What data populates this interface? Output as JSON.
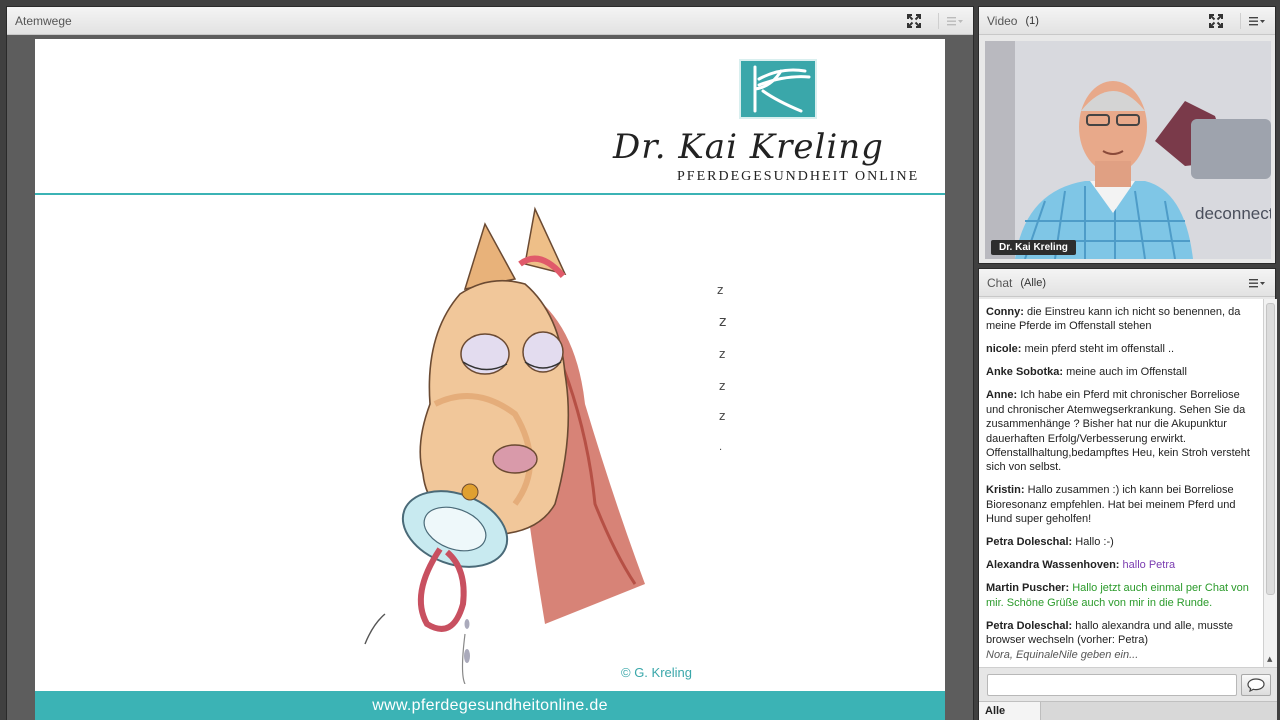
{
  "presentation_pod": {
    "title": "Atemwege",
    "slide": {
      "logo_name": "Dr. Kai Kreling",
      "logo_subtitle": "PFERDEGESUNDHEIT ONLINE",
      "copyright": "© G. Kreling",
      "footer_url": "www.pferdegesundheitonline.de"
    }
  },
  "video_pod": {
    "title": "Video",
    "count": "(1)",
    "presenter_name": "Dr. Kai Kreling",
    "background_text": "deconnect"
  },
  "chat_pod": {
    "title": "Chat",
    "scope": "(Alle)",
    "messages": [
      {
        "user": "Conny:",
        "text": "die Einstreu kann ich nicht so benennen, da meine Pferde im Offenstall stehen"
      },
      {
        "user": "nicole:",
        "text": "mein pferd steht im offenstall .."
      },
      {
        "user": "Anke Sobotka:",
        "text": "meine auch im Offenstall"
      },
      {
        "user": "Anne:",
        "text": "Ich habe ein Pferd mit chronischer Borreliose und chronischer Atemwegserkrankung. Sehen Sie da zusammenhänge ? Bisher hat nur die Akupunktur dauerhaften Erfolg/Verbesserung erwirkt. Offenstallhaltung,bedampftes Heu, kein Stroh versteht sich von selbst."
      },
      {
        "user": "Kristin:",
        "text": "Hallo zusammen :) ich kann bei Borreliose Bioresonanz empfehlen. Hat bei meinem Pferd und Hund super geholfen!"
      },
      {
        "user": "Petra Doleschal:",
        "text": "Hallo :-)"
      },
      {
        "user": "Alexandra Wassenhoven:",
        "text": "hallo Petra",
        "color": "#7a3bb0"
      },
      {
        "user": "Martin Puscher:",
        "text": "Hallo jetzt auch einmal per Chat von mir. Schöne Grüße auch von mir in die Runde.",
        "color": "#2a9a2a"
      },
      {
        "user": "Petra Doleschal:",
        "text": "hallo alexandra und alle, musste browser wechseln (vorher: Petra)"
      }
    ],
    "typing_indicator": "Nora, EquinaleNile geben ein...",
    "input_value": "",
    "tab_label": "Alle"
  },
  "colors": {
    "accent_teal": "#3bb3b5",
    "pod_header": "#e8e8e8",
    "chat_purple": "#7a3bb0",
    "chat_green": "#2a9a2a"
  }
}
